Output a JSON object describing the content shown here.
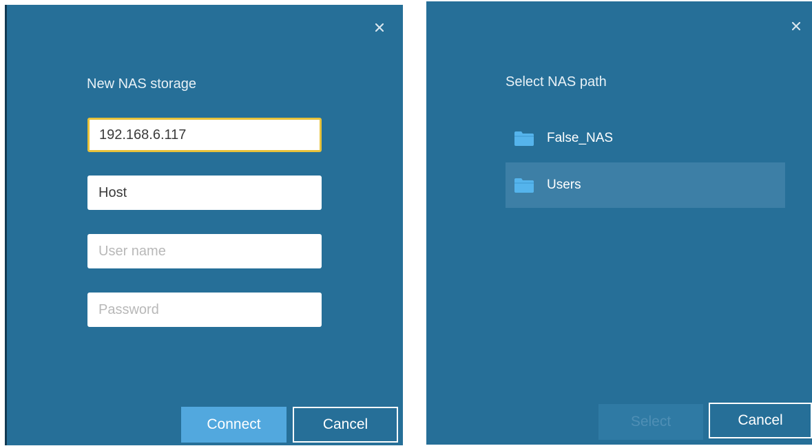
{
  "nas_dialog": {
    "title": "New NAS storage",
    "fields": {
      "address_value": "192.168.6.117",
      "host_value": "Host",
      "username_placeholder": "User name",
      "password_placeholder": "Password"
    },
    "connect_label": "Connect",
    "cancel_label": "Cancel",
    "close_icon": "close-icon"
  },
  "path_dialog": {
    "title": "Select NAS path",
    "folders": [
      {
        "label": "False_NAS",
        "icon": "folder-icon",
        "selected": false
      },
      {
        "label": "Users",
        "icon": "folder-icon",
        "selected": true
      }
    ],
    "select_label": "Select",
    "cancel_label": "Cancel",
    "close_icon": "close-icon"
  },
  "colors": {
    "dialog_bg": "#266f98",
    "primary_button": "#52a8de",
    "focus_border": "#e8c23a",
    "selected_row": "#3d7fa6",
    "folder_icon": "#55b4ec"
  }
}
